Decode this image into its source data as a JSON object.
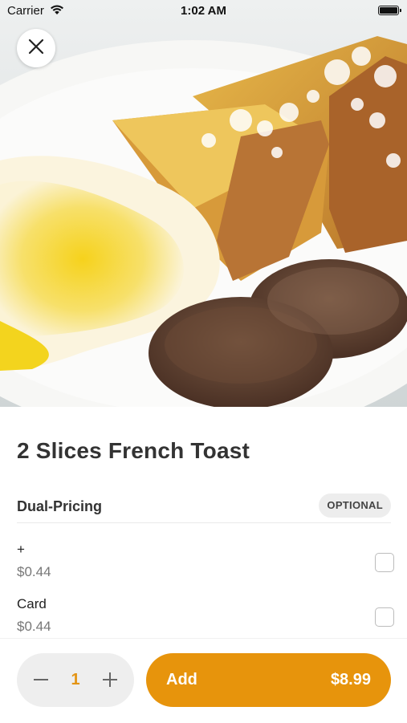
{
  "status_bar": {
    "carrier": "Carrier",
    "time": "1:02 AM"
  },
  "hero": {
    "image": "french-toast-eggs-sausage-photo"
  },
  "item": {
    "title": "2 Slices French Toast"
  },
  "modifier_group": {
    "name": "Dual-Pricing",
    "badge": "OPTIONAL",
    "options": [
      {
        "label": "+",
        "price": "$0.44",
        "checked": false
      },
      {
        "label": "Card",
        "price": "$0.44",
        "checked": false
      }
    ]
  },
  "footer": {
    "quantity": "1",
    "add_label": "Add",
    "add_price": "$8.99"
  },
  "colors": {
    "accent": "#e7940c",
    "quantity_text": "#e39414"
  }
}
